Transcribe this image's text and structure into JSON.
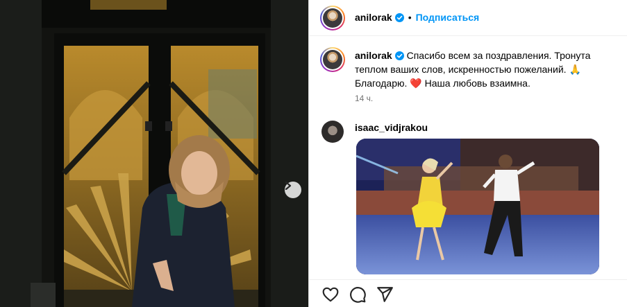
{
  "post": {
    "author": "anilorak",
    "follow_label": "Подписаться",
    "separator": "•",
    "caption_author": "anilorak",
    "caption_text": "Спасибо всем за поздравления. Тронута теплом ваших слов, искренностью пожеланий. 🙏 Благодарю. ❤️ Наша любовь взаимна.",
    "time_ago": "14 ч."
  },
  "comment": {
    "user": "isaac_vidjrakou",
    "attachment": "gif"
  },
  "media": {
    "carousel_next_icon": "chevron-right-icon"
  },
  "actions": {
    "like_icon": "heart-icon",
    "comment_icon": "comment-bubble-icon",
    "share_icon": "paper-plane-icon"
  },
  "colors": {
    "link": "#0095f6",
    "verified": "#0095f6",
    "muted": "#737373"
  }
}
